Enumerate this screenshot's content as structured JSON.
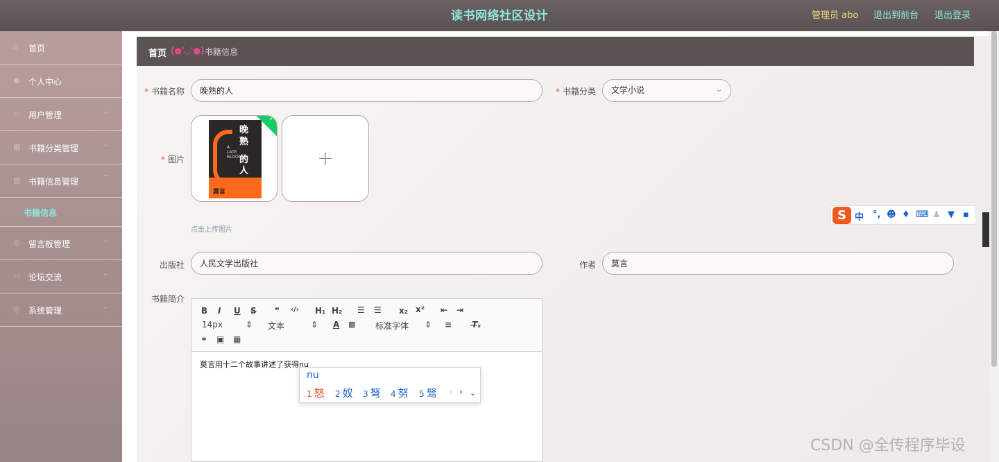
{
  "header": {
    "title": "读书网络社区设计",
    "admin": "管理员 abo",
    "exit_front": "退出到前台",
    "logout": "退出登录"
  },
  "sidebar": {
    "items": [
      {
        "label": "首页",
        "icon": "home-icon"
      },
      {
        "label": "个人中心",
        "icon": "user-icon"
      },
      {
        "label": "用户管理",
        "icon": "users-icon"
      },
      {
        "label": "书籍分类管理",
        "icon": "category-icon"
      },
      {
        "label": "书籍信息管理",
        "icon": "book-icon"
      },
      {
        "label": "留言板管理",
        "icon": "message-icon"
      },
      {
        "label": "论坛交流",
        "icon": "forum-icon"
      },
      {
        "label": "系统管理",
        "icon": "settings-icon"
      }
    ],
    "sub_item": "书籍信息"
  },
  "breadcrumb": {
    "home": "首页",
    "face": "(●'◡'●)",
    "current": "书籍信息"
  },
  "form": {
    "book_name_label": "书籍名称",
    "book_name_value": "晚熟的人",
    "category_label": "书籍分类",
    "category_value": "文学小说",
    "image_label": "图片",
    "upload_tip": "点击上传图片",
    "publisher_label": "出版社",
    "publisher_value": "人民文学出版社",
    "author_label": "作者",
    "author_value": "莫言",
    "intro_label": "书籍简介",
    "book_cover": {
      "title_lines": [
        "晚",
        "熟",
        "的",
        "人"
      ],
      "subtitle": "A LATE BLOOMER",
      "author": "莫言"
    }
  },
  "editor": {
    "font_size": "14px",
    "text_type": "文本",
    "font_family": "标准字体",
    "content": "莫言用十二个故事讲述了获得nu"
  },
  "ime": {
    "pinyin": "nu",
    "candidates": [
      {
        "n": "1",
        "c": "怒"
      },
      {
        "n": "2",
        "c": "奴"
      },
      {
        "n": "3",
        "c": "弩"
      },
      {
        "n": "4",
        "c": "努"
      },
      {
        "n": "5",
        "c": "驽"
      }
    ],
    "bar_mode": "中"
  },
  "watermark": "CSDN @全传程序毕设",
  "colors": {
    "header_bg": "#5a5252",
    "title": "#8ee6dc",
    "admin": "#f4d77a",
    "sidebar_bg": "#a58e8e",
    "required": "#e85a5a",
    "success": "#13ce66"
  }
}
